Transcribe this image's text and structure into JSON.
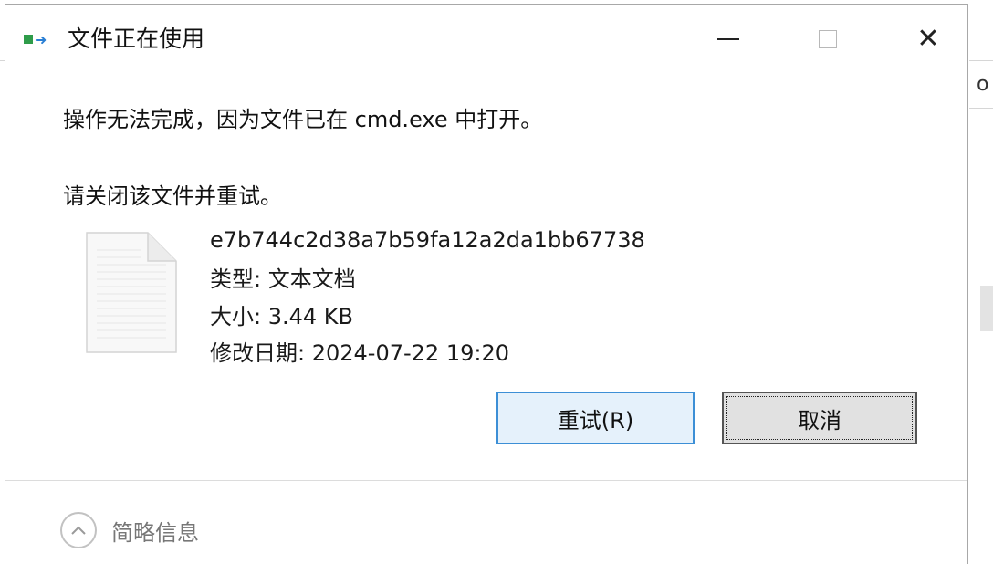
{
  "window": {
    "title": "文件正在使用",
    "minimize_icon": "minimize-icon",
    "maximize_icon": "maximize-icon",
    "close_icon": "close-icon"
  },
  "message": {
    "line1": "操作无法完成，因为文件已在 cmd.exe 中打开。",
    "line2": "请关闭该文件并重试。"
  },
  "file": {
    "icon": "text-file-icon",
    "name": "e7b744c2d38a7b59fa12a2da1bb67738",
    "type": "类型: 文本文档",
    "size": "大小: 3.44 KB",
    "modified": "修改日期: 2024-07-22 19:20"
  },
  "buttons": {
    "retry": "重试(R)",
    "cancel": "取消"
  },
  "footer": {
    "more_info": "简略信息",
    "more_icon": "chevron-up-icon"
  },
  "colors": {
    "retry_border": "#3c8fd6",
    "retry_bg": "#e5f1fb",
    "cancel_bg": "#e1e1e1"
  }
}
